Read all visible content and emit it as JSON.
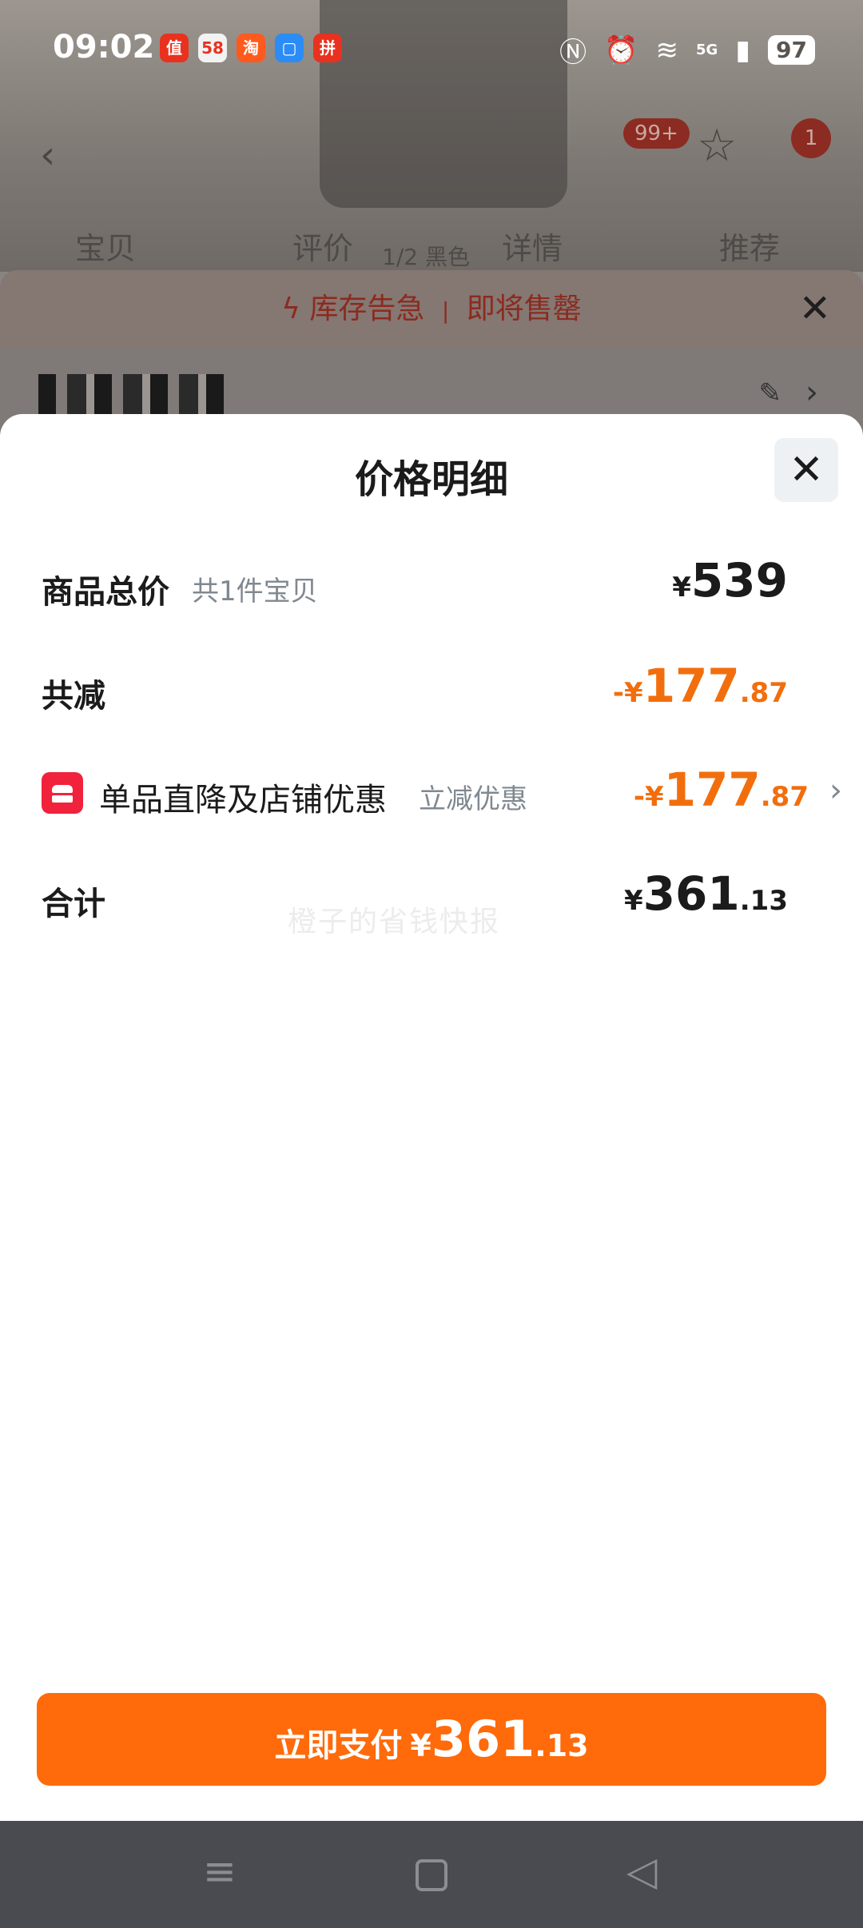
{
  "status_bar": {
    "time": "09:02",
    "app_icons": [
      {
        "name": "zhi-app-icon",
        "glyph": "值",
        "color": "#e8321f"
      },
      {
        "name": "58-app-icon",
        "glyph": "58",
        "color": "#f2f2f2"
      },
      {
        "name": "taobao-app-icon",
        "glyph": "淘",
        "color": "#ff5a1e"
      },
      {
        "name": "files-app-icon",
        "glyph": "▢",
        "color": "#2b8cf5"
      },
      {
        "name": "pinduoduo-app-icon",
        "glyph": "拼",
        "color": "#e8321f"
      }
    ],
    "network": "5G",
    "battery": "97"
  },
  "background": {
    "back_glyph": "‹",
    "cart_badge": "99+",
    "msg_badge": "1",
    "tabs": [
      "宝贝",
      "评价",
      "详情",
      "推荐"
    ],
    "image_counter": "1/2 黑色",
    "stock_alert": "库存告急",
    "stock_alert_2": "即将售罄"
  },
  "price_sheet": {
    "title": "价格明细",
    "goods_total": {
      "label": "商品总价",
      "sub": "共1件宝贝",
      "yen": "¥",
      "int": "539",
      "dec": ""
    },
    "total_reduce": {
      "label": "共减",
      "yen": "-¥",
      "int": "177",
      "dec": ".87"
    },
    "discount": {
      "label": "单品直降及店铺优惠",
      "sub": "立减优惠",
      "yen": "-¥",
      "int": "177",
      "dec": ".87"
    },
    "sum": {
      "label": "合计",
      "yen": "¥",
      "int": "361",
      "dec": ".13"
    },
    "watermark": "橙子的省钱快报"
  },
  "pay_button": {
    "label": "立即支付",
    "yen": "¥",
    "int": "361",
    "dec": ".13"
  },
  "colors": {
    "accent": "#ff6a0a",
    "discount_orange": "#f26e0d",
    "badge_red": "#f0223c"
  }
}
